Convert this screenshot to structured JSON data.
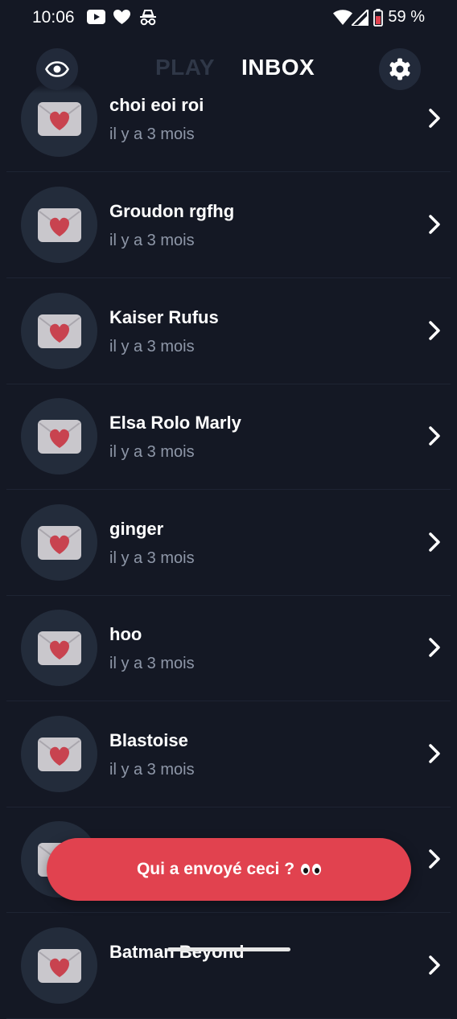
{
  "status_bar": {
    "time": "10:06",
    "battery": "59 %"
  },
  "header": {
    "tab_play": "PLAY",
    "tab_inbox": "INBOX"
  },
  "messages": [
    {
      "name": "choi eoi roi",
      "time": "il y a 3 mois"
    },
    {
      "name": "Groudon rgfhg",
      "time": "il y a 3 mois"
    },
    {
      "name": "Kaiser Rufus",
      "time": "il y a 3 mois"
    },
    {
      "name": "Elsa Rolo Marly",
      "time": "il y a 3 mois"
    },
    {
      "name": "ginger",
      "time": "il y a 3 mois"
    },
    {
      "name": "hoo",
      "time": "il y a 3 mois"
    },
    {
      "name": "Blastoise",
      "time": "il y a 3 mois"
    },
    {
      "name": "",
      "time": ""
    },
    {
      "name": "Batman Beyond",
      "time": ""
    }
  ],
  "cta": {
    "label": "Qui a envoyé ceci ?"
  },
  "colors": {
    "background": "#141824",
    "accent": "#e1424f",
    "avatar_bg": "#232c3b",
    "muted_text": "#8e97a8"
  },
  "icons": [
    "youtube-icon",
    "heart-icon",
    "incognito-icon",
    "wifi-icon",
    "signal-icon",
    "battery-icon",
    "eye-icon",
    "settings-icon",
    "love-letter-icon",
    "chevron-right-icon",
    "eyes-emoji-icon"
  ]
}
